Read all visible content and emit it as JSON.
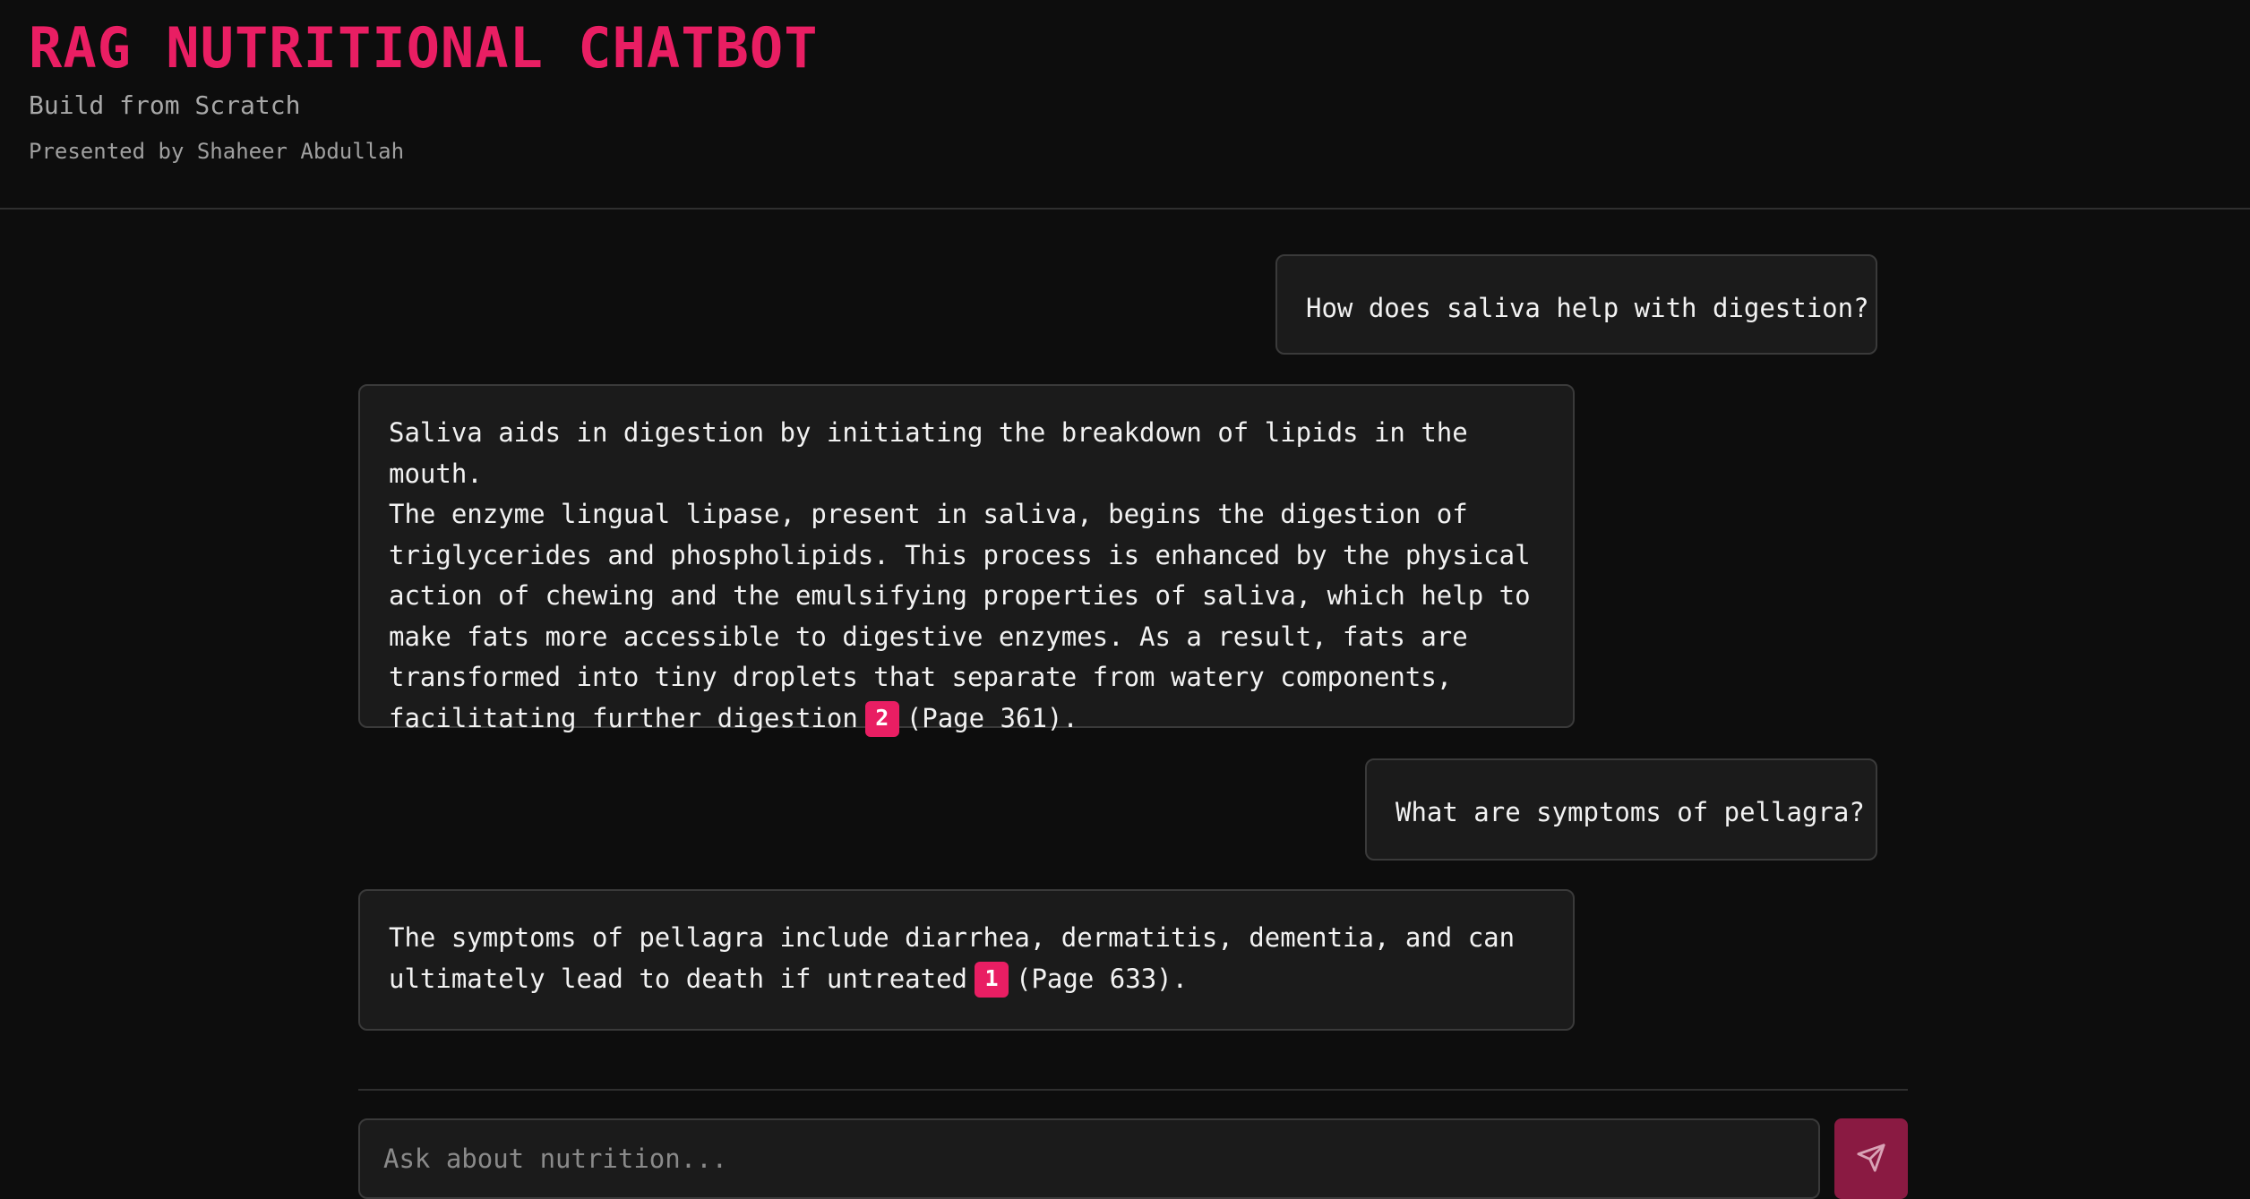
{
  "header": {
    "title": "RAG NUTRITIONAL CHATBOT",
    "subtitle": "Build from Scratch",
    "presenter": "Presented by Shaheer Abdullah"
  },
  "messages": [
    {
      "role": "user",
      "text": "How does saliva help with digestion?"
    },
    {
      "role": "assistant",
      "text": "Saliva aids in digestion by initiating the breakdown of lipids in the mouth.\nThe enzyme lingual lipase, present in saliva, begins the digestion of\ntriglycerides and phospholipids. This process is enhanced by the physical\naction of chewing and the emulsifying properties of saliva, which help to\nmake fats more accessible to digestive enzymes. As a result, fats are\ntransformed into tiny droplets that separate from watery components,\nfacilitating further digestion",
      "citation": "2",
      "suffix": "(Page 361)."
    },
    {
      "role": "user",
      "text": "What are symptoms of pellagra?"
    },
    {
      "role": "assistant",
      "text": "The symptoms of pellagra include diarrhea, dermatitis, dementia, and can\nultimately lead to death if untreated",
      "citation": "1",
      "suffix": "(Page 633)."
    }
  ],
  "composer": {
    "placeholder": "Ask about nutrition...",
    "send_icon": "send-icon"
  },
  "colors": {
    "accent": "#e91e63",
    "send_button": "#8a1a42",
    "background": "#0d0d0d",
    "bubble": "#1b1b1b"
  }
}
